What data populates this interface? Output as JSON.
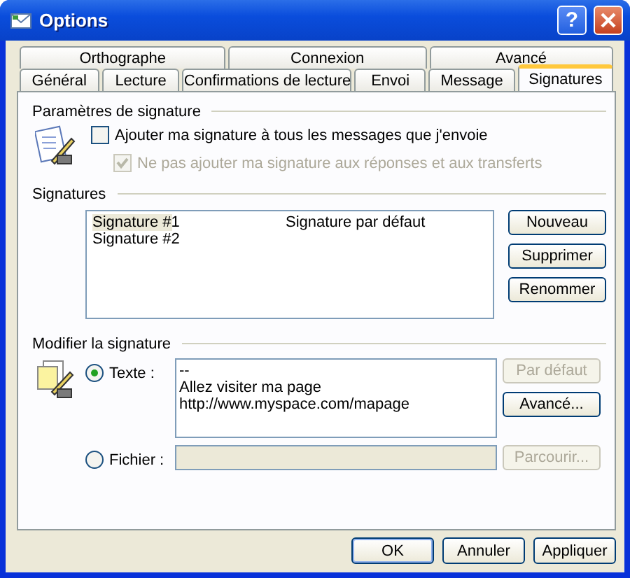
{
  "window": {
    "title": "Options",
    "help_button": "?"
  },
  "tabs": [
    [
      {
        "label": "Orthographe",
        "selected": false
      },
      {
        "label": "Connexion",
        "selected": false
      },
      {
        "label": "Avancé",
        "selected": false
      }
    ],
    [
      {
        "label": "Général",
        "selected": false
      },
      {
        "label": "Lecture",
        "selected": false
      },
      {
        "label": "Confirmations de lecture",
        "selected": false
      },
      {
        "label": "Envoi",
        "selected": false
      },
      {
        "label": "Message",
        "selected": false
      },
      {
        "label": "Signatures",
        "selected": true
      }
    ]
  ],
  "signature_settings": {
    "title": "Paramètres de signature",
    "checkboxes": [
      {
        "label": "Ajouter ma signature à tous les messages que j'envoie",
        "checked": false,
        "disabled": false
      },
      {
        "label": "Ne pas ajouter ma signature aux réponses et aux transferts",
        "checked": true,
        "disabled": true
      }
    ]
  },
  "signatures": {
    "title": "Signatures",
    "rows": [
      {
        "name": "Signature #1",
        "note": "Signature par défaut",
        "selected": true
      },
      {
        "name": "Signature #2",
        "selected": false
      }
    ],
    "buttons": [
      {
        "label": "Nouveau",
        "disabled": false
      },
      {
        "label": "Supprimer",
        "disabled": false
      },
      {
        "label": "Renommer",
        "disabled": false
      }
    ]
  },
  "edit_signature": {
    "title": "Modifier la signature",
    "text_option": {
      "label": "Texte :",
      "selected": true
    },
    "text_value": "--\nAllez visiter ma page\nhttp://www.myspace.com/mapage",
    "text_buttons": [
      {
        "label": "Par défaut",
        "disabled": true
      },
      {
        "label": "Avancé...",
        "disabled": false
      }
    ],
    "file_option": {
      "label": "Fichier :",
      "selected": false
    },
    "file_button": {
      "label": "Parcourir...",
      "disabled": true
    }
  },
  "buttons": [
    {
      "label": "OK",
      "disabled": false
    },
    {
      "label": "Annuler",
      "disabled": false
    },
    {
      "label": "Appliquer",
      "disabled": false
    }
  ]
}
